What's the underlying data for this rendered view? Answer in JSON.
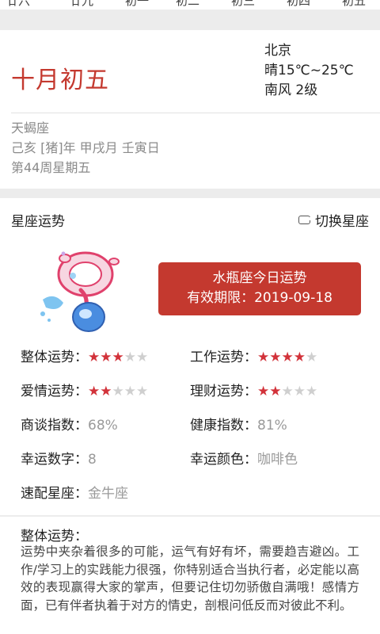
{
  "week_strip": {
    "items": [
      "廿六",
      "廿九",
      "初一",
      "初二",
      "初三",
      "初四",
      "初五"
    ]
  },
  "date_card": {
    "lunar_date": "十月初五",
    "weather": {
      "city": "北京",
      "condition": "晴15℃~25℃",
      "wind": "南风 2级"
    },
    "constellation": "天蝎座",
    "ganzhi": "己亥 [猪]年 甲戌月 壬寅日",
    "week": "第44周星期五"
  },
  "horoscope": {
    "section_title": "星座运势",
    "switch_label": "切换星座",
    "switch_icon": "swap-icon",
    "banner_title": "水瓶座今日运势",
    "banner_validity": "有效期限：2019-09-18",
    "accent_color": "#c4392f",
    "ratings": [
      {
        "label": "整体运势：",
        "stars": 3,
        "max": 5
      },
      {
        "label": "工作运势：",
        "stars": 4,
        "max": 5
      },
      {
        "label": "爱情运势：",
        "stars": 2,
        "max": 5
      },
      {
        "label": "理财运势：",
        "stars": 2,
        "max": 5
      }
    ],
    "facts": [
      {
        "label": "商谈指数：",
        "value": "68%"
      },
      {
        "label": "健康指数：",
        "value": "81%"
      },
      {
        "label": "幸运数字：",
        "value": "8"
      },
      {
        "label": "幸运颜色：",
        "value": "咖啡色"
      },
      {
        "label": "速配星座：",
        "value": "金牛座"
      }
    ]
  },
  "overall": {
    "title": "整体运势：",
    "text": "运势中夹杂着很多的可能，运气有好有坏，需要趋吉避凶。工作/学习上的实践能力很强，你特别适合当执行者，必定能以高效的表现赢得大家的掌声，但要记住切勿骄傲自满哦！感情方面，已有伴者执着于对方的情史，剖根问低反而对彼此不利。"
  }
}
